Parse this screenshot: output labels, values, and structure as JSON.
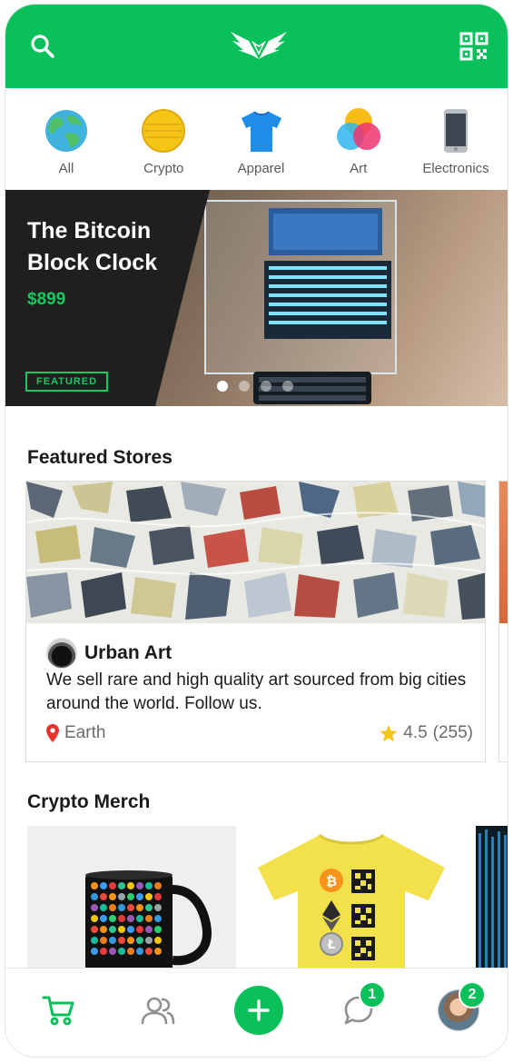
{
  "colors": {
    "brand_green": "#0ac05a",
    "price_green": "#1cc661",
    "hero_background": "#1f1f1f",
    "star_yellow": "#f5c518",
    "location_red": "#e8322e"
  },
  "header": {
    "left_icon": "search-icon",
    "logo": "wings-logo",
    "right_icon": "qr-code-icon"
  },
  "categories": [
    {
      "label": "All",
      "icon": "globe-icon"
    },
    {
      "label": "Crypto",
      "icon": "coin-icon"
    },
    {
      "label": "Apparel",
      "icon": "tshirt-icon"
    },
    {
      "label": "Art",
      "icon": "color-circles-icon"
    },
    {
      "label": "Electronics",
      "icon": "phone-icon"
    }
  ],
  "hero": {
    "title": "The Bitcoin Block Clock",
    "price": "$899",
    "badge": "FEATURED",
    "slides_total": 4,
    "active_slide": 1
  },
  "featured_stores": {
    "title": "Featured Stores",
    "stores": [
      {
        "name": "Urban Art",
        "description": "We sell rare and high quality art sourced from big cities around the world. Follow us.",
        "location": "Earth",
        "rating": "4.5",
        "reviews": "(255)"
      }
    ]
  },
  "crypto_merch": {
    "title": "Crypto Merch",
    "items": [
      {
        "name": "mug"
      },
      {
        "name": "t-shirt"
      }
    ]
  },
  "tabbar": {
    "tabs": [
      {
        "icon": "cart-icon"
      },
      {
        "icon": "people-icon"
      },
      {
        "icon": "plus-icon"
      },
      {
        "icon": "chat-icon",
        "badge": "1"
      },
      {
        "icon": "profile-avatar",
        "badge": "2"
      }
    ]
  }
}
